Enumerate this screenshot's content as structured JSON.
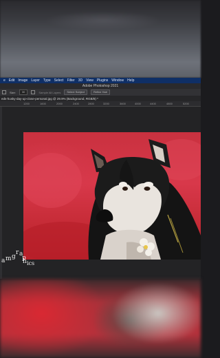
{
  "menubar": {
    "items": [
      "e",
      "Edit",
      "Image",
      "Layer",
      "Type",
      "Select",
      "Filter",
      "3D",
      "View",
      "Plugins",
      "Window",
      "Help"
    ]
  },
  "window": {
    "title": "Adobe Photoshop 2021"
  },
  "options": {
    "size_label": "Size:",
    "size_value": "30",
    "sample_label": "Sample All Layers",
    "select_subject": "Select Subject",
    "refine_hair": "Refine Hair"
  },
  "document": {
    "tab_label": "eds-husky-day-up-close-personal.jpg @ 29.9% (Background, RGB/8) *"
  },
  "ruler": {
    "ticks": [
      "1200",
      "1600",
      "2000",
      "2400",
      "2800",
      "3200",
      "3600",
      "4000",
      "4400",
      "4800",
      "5200"
    ]
  },
  "watermark": {
    "letters": [
      "a",
      "m",
      "g",
      "r",
      "a",
      "p",
      "h",
      "ics"
    ]
  },
  "colors": {
    "menubar_bg": "#0f2f66",
    "background_red": "#d8384a",
    "workspace": "#232325"
  }
}
